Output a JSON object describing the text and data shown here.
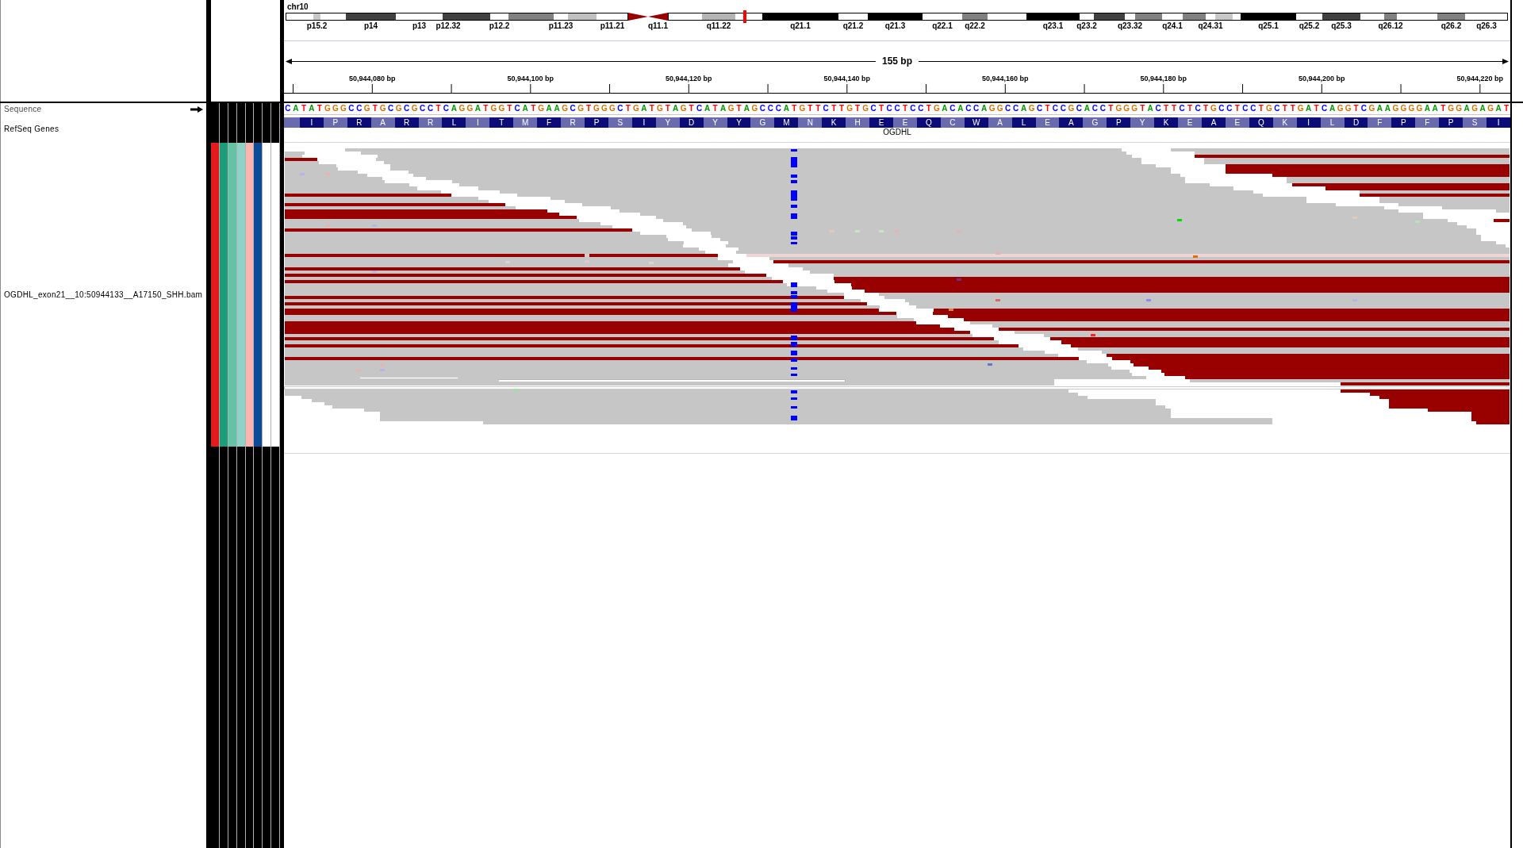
{
  "ideogram": {
    "chromosome": "chr10",
    "bands": [
      {
        "kind": "band",
        "color": "#ffffff",
        "current": false
      },
      {
        "kind": "band",
        "label": "p15.2",
        "color": "#c8c8c8",
        "current": false
      },
      {
        "kind": "band",
        "color": "#ffffff",
        "current": false
      },
      {
        "kind": "band",
        "label": "p14",
        "color": "#404040",
        "current": false
      },
      {
        "kind": "band",
        "label": "p13",
        "color": "#ffffff",
        "current": false
      },
      {
        "kind": "band",
        "label": "p12.32",
        "color": "#404040",
        "current": false
      },
      {
        "kind": "band",
        "color": "#404040",
        "current": false
      },
      {
        "kind": "band",
        "label": "p12.2",
        "color": "#ffffff",
        "current": false
      },
      {
        "kind": "band",
        "color": "#808080",
        "current": false
      },
      {
        "kind": "band",
        "label": "p11.23",
        "color": "#ffffff",
        "current": false
      },
      {
        "kind": "band",
        "color": "#c0c0c0",
        "current": false
      },
      {
        "kind": "band",
        "label": "p11.21",
        "color": "#ffffff",
        "current": false
      },
      {
        "kind": "p_centromere",
        "color": "#990000",
        "current": false
      },
      {
        "kind": "q_centromere",
        "label": "q11.1",
        "color": "#990000",
        "current": false
      },
      {
        "kind": "band",
        "color": "#ffffff",
        "current": false
      },
      {
        "kind": "band",
        "label": "q11.22",
        "color": "#b4b4b4",
        "current": false
      },
      {
        "kind": "band",
        "color": "#ffffff",
        "current": true
      },
      {
        "kind": "band",
        "label": "q21.1",
        "color": "#000000",
        "current": false
      },
      {
        "kind": "band",
        "label": "q21.2",
        "color": "#ffffff",
        "current": false
      },
      {
        "kind": "band",
        "label": "q21.3",
        "color": "#000000",
        "current": false
      },
      {
        "kind": "band",
        "label": "q22.1",
        "color": "#ffffff",
        "current": false
      },
      {
        "kind": "band",
        "label": "q22.2",
        "color": "#808080",
        "current": false
      },
      {
        "kind": "band",
        "color": "#ffffff",
        "current": false
      },
      {
        "kind": "band",
        "label": "q23.1",
        "color": "#000000",
        "current": false
      },
      {
        "kind": "band",
        "label": "q23.2",
        "color": "#ffffff",
        "current": false
      },
      {
        "kind": "band",
        "color": "#404040",
        "current": false
      },
      {
        "kind": "band",
        "label": "q23.32",
        "color": "#ffffff",
        "current": false
      },
      {
        "kind": "band",
        "color": "#808080",
        "current": false
      },
      {
        "kind": "band",
        "label": "q24.1",
        "color": "#ffffff",
        "current": false
      },
      {
        "kind": "band",
        "color": "#808080",
        "current": false
      },
      {
        "kind": "band",
        "label": "q24.31",
        "color": "#ffffff",
        "current": false
      },
      {
        "kind": "band",
        "color": "#c8c8c8",
        "current": false
      },
      {
        "kind": "band",
        "color": "#ffffff",
        "current": false
      },
      {
        "kind": "band",
        "label": "q25.1",
        "color": "#000000",
        "current": false
      },
      {
        "kind": "band",
        "label": "q25.2",
        "color": "#ffffff",
        "current": false
      },
      {
        "kind": "band",
        "label": "q25.3",
        "color": "#404040",
        "current": false
      },
      {
        "kind": "band",
        "color": "#ffffff",
        "current": false
      },
      {
        "kind": "band",
        "label": "q26.12",
        "color": "#808080",
        "current": false
      },
      {
        "kind": "band",
        "color": "#ffffff",
        "current": false
      },
      {
        "kind": "band",
        "label": "q26.2",
        "color": "#808080",
        "current": false
      },
      {
        "kind": "band",
        "label": "q26.3",
        "color": "#ffffff",
        "current": false
      }
    ]
  },
  "ruler": {
    "span": "155 bp",
    "ticks": [
      "50,944,080 bp",
      "50,944,100 bp",
      "50,944,120 bp",
      "50,944,140 bp",
      "50,944,160 bp",
      "50,944,180 bp",
      "50,944,200 bp",
      "50,944,220 bp"
    ]
  },
  "tracks": [
    {
      "kind": "sequence",
      "name": "Sequence",
      "forward_strand": true,
      "bases": [
        {
          "base": "C",
          "color": "#0000ff"
        },
        {
          "base": "A",
          "color": "#009600"
        },
        {
          "base": "T",
          "color": "#ff0000"
        },
        {
          "base": "A",
          "color": "#009600"
        },
        {
          "base": "T",
          "color": "#ff0000"
        },
        {
          "base": "G",
          "color": "#d17105"
        },
        {
          "base": "G",
          "color": "#d17105"
        },
        {
          "base": "G",
          "color": "#d17105"
        },
        {
          "base": "C",
          "color": "#0000ff"
        },
        {
          "base": "C",
          "color": "#0000ff"
        },
        {
          "base": "G",
          "color": "#d17105"
        },
        {
          "base": "T",
          "color": "#ff0000"
        },
        {
          "base": "G",
          "color": "#d17105"
        },
        {
          "base": "C",
          "color": "#0000ff"
        },
        {
          "base": "G",
          "color": "#d17105"
        },
        {
          "base": "C",
          "color": "#0000ff"
        },
        {
          "base": "G",
          "color": "#d17105"
        },
        {
          "base": "C",
          "color": "#0000ff"
        },
        {
          "base": "C",
          "color": "#0000ff"
        },
        {
          "base": "T",
          "color": "#ff0000"
        },
        {
          "base": "C",
          "color": "#0000ff"
        },
        {
          "base": "A",
          "color": "#009600"
        },
        {
          "base": "G",
          "color": "#d17105"
        },
        {
          "base": "G",
          "color": "#d17105"
        },
        {
          "base": "A",
          "color": "#009600"
        },
        {
          "base": "T",
          "color": "#ff0000"
        },
        {
          "base": "G",
          "color": "#d17105"
        },
        {
          "base": "G",
          "color": "#d17105"
        },
        {
          "base": "T",
          "color": "#ff0000"
        },
        {
          "base": "C",
          "color": "#0000ff"
        },
        {
          "base": "A",
          "color": "#009600"
        },
        {
          "base": "T",
          "color": "#ff0000"
        },
        {
          "base": "G",
          "color": "#d17105"
        },
        {
          "base": "A",
          "color": "#009600"
        },
        {
          "base": "A",
          "color": "#009600"
        },
        {
          "base": "G",
          "color": "#d17105"
        },
        {
          "base": "C",
          "color": "#0000ff"
        },
        {
          "base": "G",
          "color": "#d17105"
        },
        {
          "base": "T",
          "color": "#ff0000"
        },
        {
          "base": "G",
          "color": "#d17105"
        },
        {
          "base": "G",
          "color": "#d17105"
        },
        {
          "base": "G",
          "color": "#d17105"
        },
        {
          "base": "C",
          "color": "#0000ff"
        },
        {
          "base": "T",
          "color": "#ff0000"
        },
        {
          "base": "G",
          "color": "#d17105"
        },
        {
          "base": "A",
          "color": "#009600"
        },
        {
          "base": "T",
          "color": "#ff0000"
        },
        {
          "base": "G",
          "color": "#d17105"
        },
        {
          "base": "T",
          "color": "#ff0000"
        },
        {
          "base": "A",
          "color": "#009600"
        },
        {
          "base": "G",
          "color": "#d17105"
        },
        {
          "base": "T",
          "color": "#ff0000"
        },
        {
          "base": "C",
          "color": "#0000ff"
        },
        {
          "base": "A",
          "color": "#009600"
        },
        {
          "base": "T",
          "color": "#ff0000"
        },
        {
          "base": "A",
          "color": "#009600"
        },
        {
          "base": "G",
          "color": "#d17105"
        },
        {
          "base": "T",
          "color": "#ff0000"
        },
        {
          "base": "A",
          "color": "#009600"
        },
        {
          "base": "G",
          "color": "#d17105"
        },
        {
          "base": "C",
          "color": "#0000ff"
        },
        {
          "base": "C",
          "color": "#0000ff"
        },
        {
          "base": "C",
          "color": "#0000ff"
        },
        {
          "base": "A",
          "color": "#009600"
        },
        {
          "base": "T",
          "color": "#ff0000"
        },
        {
          "base": "G",
          "color": "#d17105"
        },
        {
          "base": "T",
          "color": "#ff0000"
        },
        {
          "base": "T",
          "color": "#ff0000"
        },
        {
          "base": "C",
          "color": "#0000ff"
        },
        {
          "base": "T",
          "color": "#ff0000"
        },
        {
          "base": "T",
          "color": "#ff0000"
        },
        {
          "base": "G",
          "color": "#d17105"
        },
        {
          "base": "T",
          "color": "#ff0000"
        },
        {
          "base": "G",
          "color": "#d17105"
        },
        {
          "base": "C",
          "color": "#0000ff"
        },
        {
          "base": "T",
          "color": "#ff0000"
        },
        {
          "base": "C",
          "color": "#0000ff"
        },
        {
          "base": "C",
          "color": "#0000ff"
        },
        {
          "base": "T",
          "color": "#ff0000"
        },
        {
          "base": "C",
          "color": "#0000ff"
        },
        {
          "base": "C",
          "color": "#0000ff"
        },
        {
          "base": "T",
          "color": "#ff0000"
        },
        {
          "base": "G",
          "color": "#d17105"
        },
        {
          "base": "A",
          "color": "#009600"
        },
        {
          "base": "C",
          "color": "#0000ff"
        },
        {
          "base": "A",
          "color": "#009600"
        },
        {
          "base": "C",
          "color": "#0000ff"
        },
        {
          "base": "C",
          "color": "#0000ff"
        },
        {
          "base": "A",
          "color": "#009600"
        },
        {
          "base": "G",
          "color": "#d17105"
        },
        {
          "base": "G",
          "color": "#d17105"
        },
        {
          "base": "C",
          "color": "#0000ff"
        },
        {
          "base": "C",
          "color": "#0000ff"
        },
        {
          "base": "A",
          "color": "#009600"
        },
        {
          "base": "G",
          "color": "#d17105"
        },
        {
          "base": "C",
          "color": "#0000ff"
        },
        {
          "base": "T",
          "color": "#ff0000"
        },
        {
          "base": "C",
          "color": "#0000ff"
        },
        {
          "base": "C",
          "color": "#0000ff"
        },
        {
          "base": "G",
          "color": "#d17105"
        },
        {
          "base": "C",
          "color": "#0000ff"
        },
        {
          "base": "A",
          "color": "#009600"
        },
        {
          "base": "C",
          "color": "#0000ff"
        },
        {
          "base": "C",
          "color": "#0000ff"
        },
        {
          "base": "T",
          "color": "#ff0000"
        },
        {
          "base": "G",
          "color": "#d17105"
        },
        {
          "base": "G",
          "color": "#d17105"
        },
        {
          "base": "G",
          "color": "#d17105"
        },
        {
          "base": "T",
          "color": "#ff0000"
        },
        {
          "base": "A",
          "color": "#009600"
        },
        {
          "base": "C",
          "color": "#0000ff"
        },
        {
          "base": "T",
          "color": "#ff0000"
        },
        {
          "base": "T",
          "color": "#ff0000"
        },
        {
          "base": "C",
          "color": "#0000ff"
        },
        {
          "base": "T",
          "color": "#ff0000"
        },
        {
          "base": "C",
          "color": "#0000ff"
        },
        {
          "base": "T",
          "color": "#ff0000"
        },
        {
          "base": "G",
          "color": "#d17105"
        },
        {
          "base": "C",
          "color": "#0000ff"
        },
        {
          "base": "C",
          "color": "#0000ff"
        },
        {
          "base": "T",
          "color": "#ff0000"
        },
        {
          "base": "C",
          "color": "#0000ff"
        },
        {
          "base": "C",
          "color": "#0000ff"
        },
        {
          "base": "T",
          "color": "#ff0000"
        },
        {
          "base": "G",
          "color": "#d17105"
        },
        {
          "base": "C",
          "color": "#0000ff"
        },
        {
          "base": "T",
          "color": "#ff0000"
        },
        {
          "base": "T",
          "color": "#ff0000"
        },
        {
          "base": "G",
          "color": "#d17105"
        },
        {
          "base": "A",
          "color": "#009600"
        },
        {
          "base": "T",
          "color": "#ff0000"
        },
        {
          "base": "C",
          "color": "#0000ff"
        },
        {
          "base": "A",
          "color": "#009600"
        },
        {
          "base": "G",
          "color": "#d17105"
        },
        {
          "base": "G",
          "color": "#d17105"
        },
        {
          "base": "T",
          "color": "#ff0000"
        },
        {
          "base": "C",
          "color": "#0000ff"
        },
        {
          "base": "G",
          "color": "#d17105"
        },
        {
          "base": "A",
          "color": "#009600"
        },
        {
          "base": "A",
          "color": "#009600"
        },
        {
          "base": "G",
          "color": "#d17105"
        },
        {
          "base": "G",
          "color": "#d17105"
        },
        {
          "base": "G",
          "color": "#d17105"
        },
        {
          "base": "G",
          "color": "#d17105"
        },
        {
          "base": "A",
          "color": "#009600"
        },
        {
          "base": "A",
          "color": "#009600"
        },
        {
          "base": "T",
          "color": "#ff0000"
        },
        {
          "base": "G",
          "color": "#d17105"
        },
        {
          "base": "G",
          "color": "#d17105"
        },
        {
          "base": "A",
          "color": "#009600"
        },
        {
          "base": "G",
          "color": "#d17105"
        },
        {
          "base": "A",
          "color": "#009600"
        },
        {
          "base": "G",
          "color": "#d17105"
        },
        {
          "base": "A",
          "color": "#009600"
        },
        {
          "base": "T",
          "color": "#ff0000"
        }
      ]
    },
    {
      "kind": "gene",
      "name": "RefSeq Genes",
      "gene": "OGDHL",
      "amino_acids": [
        "I",
        "P",
        "R",
        "A",
        "R",
        "R",
        "L",
        "I",
        "T",
        "M",
        "F",
        "R",
        "P",
        "S",
        "I",
        "Y",
        "D",
        "Y",
        "Y",
        "G",
        "M",
        "N",
        "K",
        "H",
        "E",
        "E",
        "Q",
        "C",
        "W",
        "A",
        "L",
        "E",
        "A",
        "G",
        "P",
        "Y",
        "K",
        "E",
        "A",
        "E",
        "Q",
        "K",
        "I",
        "L",
        "D",
        "F",
        "P",
        "F",
        "P",
        "S",
        "I"
      ]
    },
    {
      "kind": "alignment",
      "name": "OGDHL_exon21__10:50944133__A17150_SHH.bam",
      "attributes": [
        {
          "color": "#e41a1c"
        },
        {
          "color": "#1b9e77"
        },
        {
          "color": "#66c2a5"
        },
        {
          "color": "#8dd3c7"
        },
        {
          "color": "#fbb4ae"
        },
        {
          "color": "#0b4a96"
        },
        {
          "color": "#ffffff"
        },
        {
          "color": "#ffffff"
        }
      ]
    }
  ]
}
